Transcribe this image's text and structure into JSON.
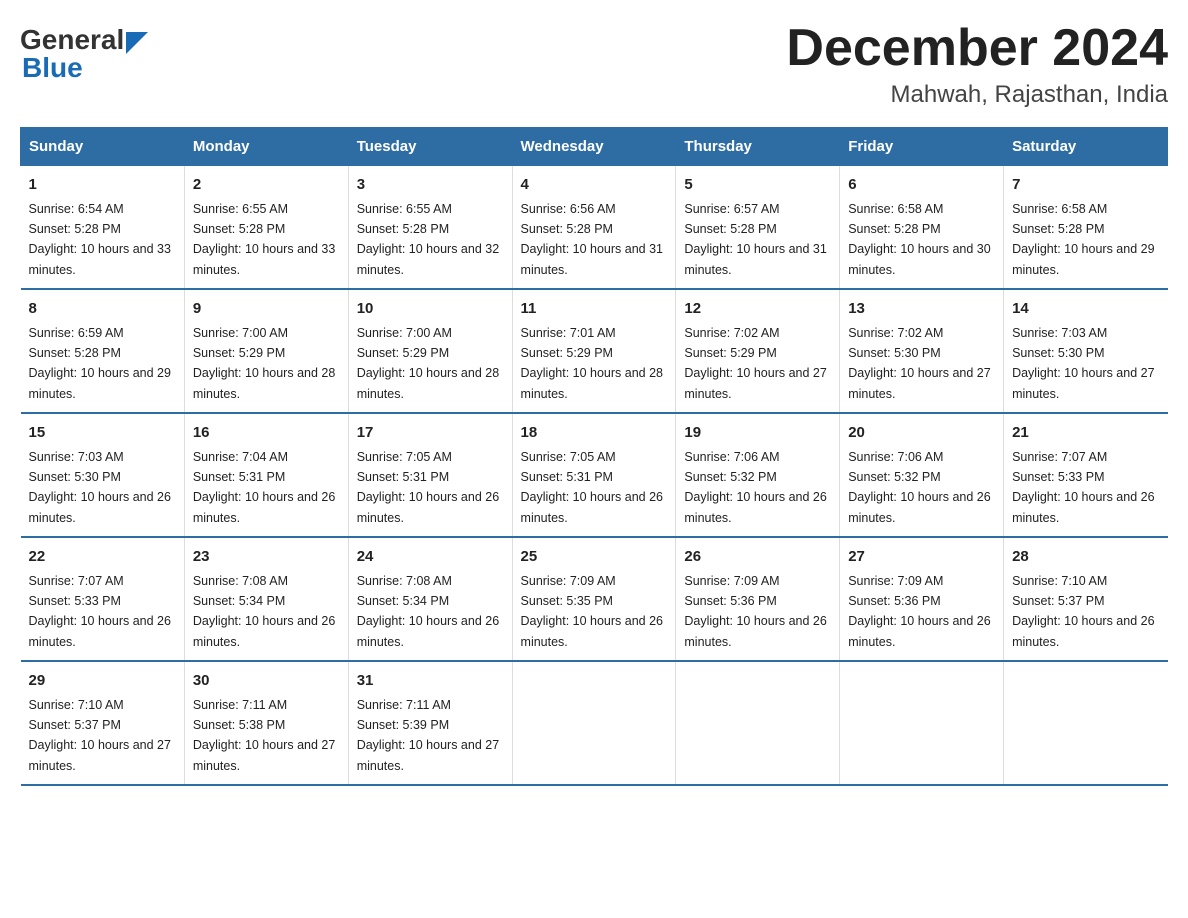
{
  "header": {
    "logo_general": "General",
    "logo_blue": "Blue",
    "month": "December 2024",
    "location": "Mahwah, Rajasthan, India"
  },
  "days_of_week": [
    "Sunday",
    "Monday",
    "Tuesday",
    "Wednesday",
    "Thursday",
    "Friday",
    "Saturday"
  ],
  "weeks": [
    [
      {
        "day": "1",
        "sunrise": "6:54 AM",
        "sunset": "5:28 PM",
        "daylight": "10 hours and 33 minutes."
      },
      {
        "day": "2",
        "sunrise": "6:55 AM",
        "sunset": "5:28 PM",
        "daylight": "10 hours and 33 minutes."
      },
      {
        "day": "3",
        "sunrise": "6:55 AM",
        "sunset": "5:28 PM",
        "daylight": "10 hours and 32 minutes."
      },
      {
        "day": "4",
        "sunrise": "6:56 AM",
        "sunset": "5:28 PM",
        "daylight": "10 hours and 31 minutes."
      },
      {
        "day": "5",
        "sunrise": "6:57 AM",
        "sunset": "5:28 PM",
        "daylight": "10 hours and 31 minutes."
      },
      {
        "day": "6",
        "sunrise": "6:58 AM",
        "sunset": "5:28 PM",
        "daylight": "10 hours and 30 minutes."
      },
      {
        "day": "7",
        "sunrise": "6:58 AM",
        "sunset": "5:28 PM",
        "daylight": "10 hours and 29 minutes."
      }
    ],
    [
      {
        "day": "8",
        "sunrise": "6:59 AM",
        "sunset": "5:28 PM",
        "daylight": "10 hours and 29 minutes."
      },
      {
        "day": "9",
        "sunrise": "7:00 AM",
        "sunset": "5:29 PM",
        "daylight": "10 hours and 28 minutes."
      },
      {
        "day": "10",
        "sunrise": "7:00 AM",
        "sunset": "5:29 PM",
        "daylight": "10 hours and 28 minutes."
      },
      {
        "day": "11",
        "sunrise": "7:01 AM",
        "sunset": "5:29 PM",
        "daylight": "10 hours and 28 minutes."
      },
      {
        "day": "12",
        "sunrise": "7:02 AM",
        "sunset": "5:29 PM",
        "daylight": "10 hours and 27 minutes."
      },
      {
        "day": "13",
        "sunrise": "7:02 AM",
        "sunset": "5:30 PM",
        "daylight": "10 hours and 27 minutes."
      },
      {
        "day": "14",
        "sunrise": "7:03 AM",
        "sunset": "5:30 PM",
        "daylight": "10 hours and 27 minutes."
      }
    ],
    [
      {
        "day": "15",
        "sunrise": "7:03 AM",
        "sunset": "5:30 PM",
        "daylight": "10 hours and 26 minutes."
      },
      {
        "day": "16",
        "sunrise": "7:04 AM",
        "sunset": "5:31 PM",
        "daylight": "10 hours and 26 minutes."
      },
      {
        "day": "17",
        "sunrise": "7:05 AM",
        "sunset": "5:31 PM",
        "daylight": "10 hours and 26 minutes."
      },
      {
        "day": "18",
        "sunrise": "7:05 AM",
        "sunset": "5:31 PM",
        "daylight": "10 hours and 26 minutes."
      },
      {
        "day": "19",
        "sunrise": "7:06 AM",
        "sunset": "5:32 PM",
        "daylight": "10 hours and 26 minutes."
      },
      {
        "day": "20",
        "sunrise": "7:06 AM",
        "sunset": "5:32 PM",
        "daylight": "10 hours and 26 minutes."
      },
      {
        "day": "21",
        "sunrise": "7:07 AM",
        "sunset": "5:33 PM",
        "daylight": "10 hours and 26 minutes."
      }
    ],
    [
      {
        "day": "22",
        "sunrise": "7:07 AM",
        "sunset": "5:33 PM",
        "daylight": "10 hours and 26 minutes."
      },
      {
        "day": "23",
        "sunrise": "7:08 AM",
        "sunset": "5:34 PM",
        "daylight": "10 hours and 26 minutes."
      },
      {
        "day": "24",
        "sunrise": "7:08 AM",
        "sunset": "5:34 PM",
        "daylight": "10 hours and 26 minutes."
      },
      {
        "day": "25",
        "sunrise": "7:09 AM",
        "sunset": "5:35 PM",
        "daylight": "10 hours and 26 minutes."
      },
      {
        "day": "26",
        "sunrise": "7:09 AM",
        "sunset": "5:36 PM",
        "daylight": "10 hours and 26 minutes."
      },
      {
        "day": "27",
        "sunrise": "7:09 AM",
        "sunset": "5:36 PM",
        "daylight": "10 hours and 26 minutes."
      },
      {
        "day": "28",
        "sunrise": "7:10 AM",
        "sunset": "5:37 PM",
        "daylight": "10 hours and 26 minutes."
      }
    ],
    [
      {
        "day": "29",
        "sunrise": "7:10 AM",
        "sunset": "5:37 PM",
        "daylight": "10 hours and 27 minutes."
      },
      {
        "day": "30",
        "sunrise": "7:11 AM",
        "sunset": "5:38 PM",
        "daylight": "10 hours and 27 minutes."
      },
      {
        "day": "31",
        "sunrise": "7:11 AM",
        "sunset": "5:39 PM",
        "daylight": "10 hours and 27 minutes."
      },
      {
        "day": "",
        "sunrise": "",
        "sunset": "",
        "daylight": ""
      },
      {
        "day": "",
        "sunrise": "",
        "sunset": "",
        "daylight": ""
      },
      {
        "day": "",
        "sunrise": "",
        "sunset": "",
        "daylight": ""
      },
      {
        "day": "",
        "sunrise": "",
        "sunset": "",
        "daylight": ""
      }
    ]
  ]
}
